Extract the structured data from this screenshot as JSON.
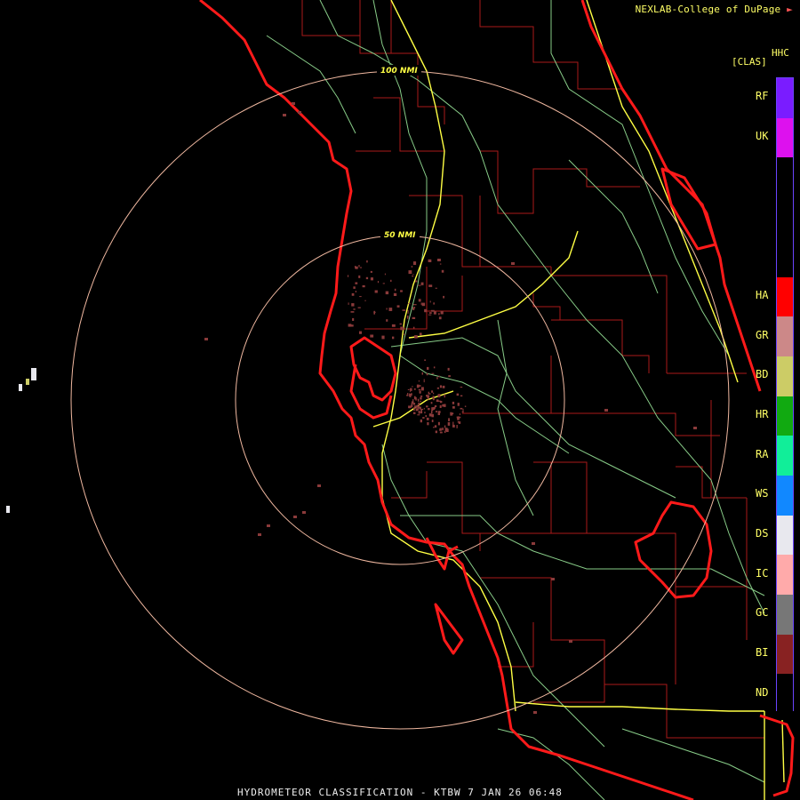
{
  "header": {
    "credit": "NEXLAB-College of DuPage",
    "product_code": "HHC",
    "class_label": "[CLAS]"
  },
  "footer": {
    "title": "HYDROMETEOR CLASSIFICATION - KTBW 7 JAN 26 06:48"
  },
  "rings": [
    {
      "label": "100 NMI"
    },
    {
      "label": "50 NMI"
    }
  ],
  "legend": [
    {
      "code": "RF",
      "color": "#7a1cff"
    },
    {
      "code": "UK",
      "color": "#dd11ee"
    },
    {
      "code": "",
      "color": "#000000"
    },
    {
      "code": "HA",
      "color": "#ff0000"
    },
    {
      "code": "GR",
      "color": "#cc8888"
    },
    {
      "code": "BD",
      "color": "#cccc66"
    },
    {
      "code": "HR",
      "color": "#11aa11"
    },
    {
      "code": "RA",
      "color": "#11ee99"
    },
    {
      "code": "WS",
      "color": "#1188ff"
    },
    {
      "code": "DS",
      "color": "#e8e8ee"
    },
    {
      "code": "IC",
      "color": "#ffaaaa"
    },
    {
      "code": "GC",
      "color": "#777777"
    },
    {
      "code": "BI",
      "color": "#882222"
    },
    {
      "code": "ND",
      "color": "#000000"
    }
  ],
  "colors": {
    "coastline": "#ff1a1a",
    "county": "#aa1a1a",
    "highway": "#ffff44",
    "road": "#88cc88",
    "ring": "#f0b8a0",
    "echo": "#8a3a3a"
  }
}
